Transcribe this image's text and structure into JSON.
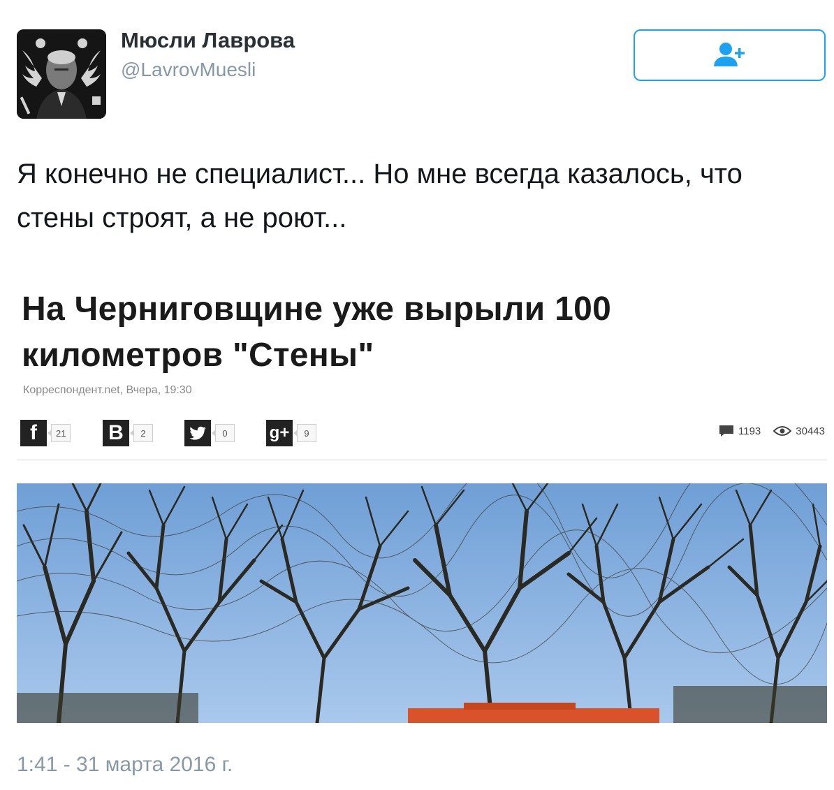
{
  "user": {
    "name": "Мюсли Лаврова",
    "handle": "@LavrovMuesli"
  },
  "follow_button": {
    "icon": "add-user-icon",
    "color": "#1da1f2"
  },
  "tweet": {
    "text": "Я конечно не специалист... Но мне всегда казалось, что стены строят, а не роют...",
    "timestamp": "1:41 - 31 марта 2016 г."
  },
  "embedded_article": {
    "headline": "На Черниговщине уже вырыли 100 километров \"Стены\"",
    "meta": "Корреспондент.net, Вчера, 19:30",
    "share": [
      {
        "network": "facebook",
        "icon_label": "f",
        "count": "21"
      },
      {
        "network": "vkontakte",
        "icon_label": "B",
        "count": "2"
      },
      {
        "network": "twitter",
        "icon_label": "",
        "count": "0"
      },
      {
        "network": "google-plus",
        "icon_label": "g+",
        "count": "9"
      }
    ],
    "comments_count": "1193",
    "views_count": "30443"
  }
}
